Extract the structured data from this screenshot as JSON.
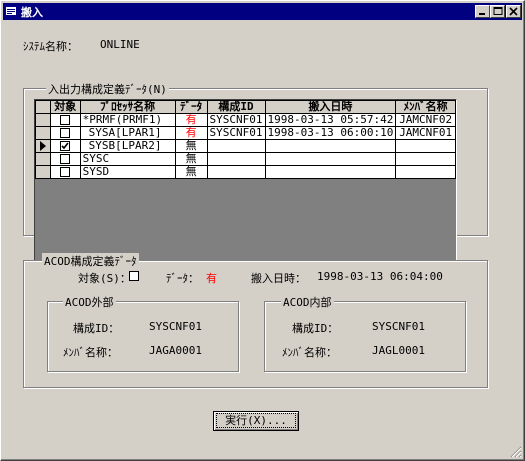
{
  "window": {
    "title": "搬入"
  },
  "system": {
    "label": "ｼｽﾃﾑ名称：",
    "value": "ONLINE"
  },
  "io_group": {
    "title": "入出力構成定義ﾃﾞｰﾀ(N)"
  },
  "table": {
    "headers": [
      "対象",
      "ﾌﾟﾛｾｯｻ名称",
      "ﾃﾞｰﾀ",
      "構成ID",
      "搬入日時",
      "ﾒﾝﾊﾞ名称"
    ],
    "rows": [
      {
        "pointer": false,
        "checked": false,
        "name": "*PRMF(PRMF1)",
        "data": "有",
        "config_id": "SYSCNF01",
        "datetime": "1998-03-13 05:57:42",
        "member": "JAMCNF02"
      },
      {
        "pointer": false,
        "checked": false,
        "name": " SYSA[LPAR1]",
        "data": "有",
        "config_id": "SYSCNF01",
        "datetime": "1998-03-13 06:00:10",
        "member": "JAMCNF01"
      },
      {
        "pointer": true,
        "checked": true,
        "name": " SYSB[LPAR2]",
        "data": "無",
        "config_id": "",
        "datetime": "",
        "member": ""
      },
      {
        "pointer": false,
        "checked": false,
        "name": "SYSC",
        "data": "無",
        "config_id": "",
        "datetime": "",
        "member": ""
      },
      {
        "pointer": false,
        "checked": false,
        "name": "SYSD",
        "data": "無",
        "config_id": "",
        "datetime": "",
        "member": ""
      }
    ]
  },
  "acod": {
    "title": "ACOD構成定義ﾃﾞｰﾀ",
    "target_label": "対象(S)：",
    "data_label": "ﾃﾞｰﾀ：",
    "data_value": "有",
    "date_label": "搬入日時：",
    "date_value": "1998-03-13 06:04:00",
    "outer": {
      "title": "ACOD外部",
      "id_label": "構成ID：",
      "id_value": "SYSCNF01",
      "member_label": "ﾒﾝﾊﾞ名称：",
      "member_value": "JAGA0001"
    },
    "inner": {
      "title": "ACOD内部",
      "id_label": "構成ID：",
      "id_value": "SYSCNF01",
      "member_label": "ﾒﾝﾊﾞ名称：",
      "member_value": "JAGL0001"
    }
  },
  "execute_button": "実行(X)...",
  "colors": {
    "title_bar": "#000080",
    "face": "#d4d0c8",
    "has_data": "#ff0000"
  }
}
